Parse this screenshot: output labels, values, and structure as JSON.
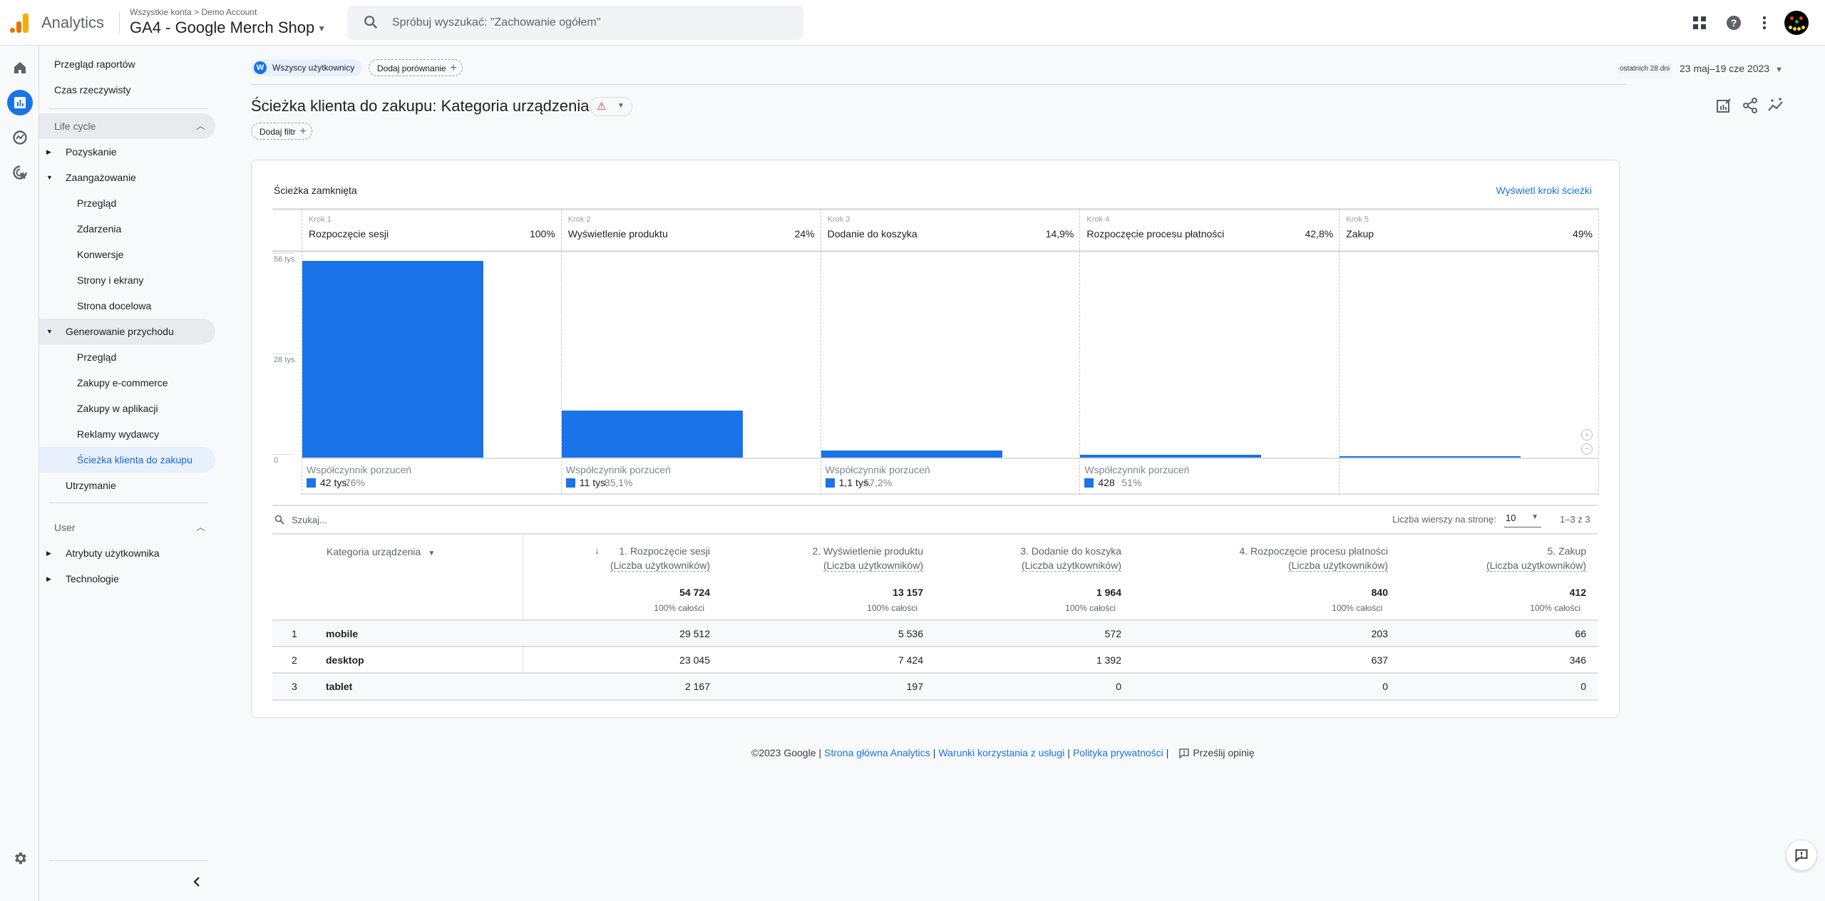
{
  "topbar": {
    "app_name": "Analytics",
    "breadcrumb": "Wszystkie konta > Demo Account",
    "property": "GA4 - Google Merch Shop",
    "search_placeholder": "Spróbuj wyszukać: \"Zachowanie ogółem\"",
    "icons": [
      "apps-grid-icon",
      "help-icon",
      "more-vert-icon",
      "avatar"
    ]
  },
  "rail": {
    "icons": [
      "home-icon",
      "reports-icon",
      "explore-icon",
      "advertising-icon",
      "settings-icon"
    ],
    "active": "reports-icon"
  },
  "sidebar": {
    "top_items": [
      {
        "label": "Przegląd raportów"
      },
      {
        "label": "Czas rzeczywisty"
      }
    ],
    "sections": [
      {
        "title": "Life cycle",
        "expanded": true,
        "groups": [
          {
            "label": "Pozyskanie",
            "expanded": false,
            "items": []
          },
          {
            "label": "Zaangażowanie",
            "expanded": true,
            "items": [
              {
                "label": "Przegląd"
              },
              {
                "label": "Zdarzenia"
              },
              {
                "label": "Konwersje"
              },
              {
                "label": "Strony i ekrany"
              },
              {
                "label": "Strona docelowa"
              }
            ]
          },
          {
            "label": "Generowanie przychodu",
            "expanded": true,
            "items": [
              {
                "label": "Przegląd"
              },
              {
                "label": "Zakupy e-commerce"
              },
              {
                "label": "Zakupy w aplikacji"
              },
              {
                "label": "Reklamy wydawcy"
              },
              {
                "label": "Ścieżka klienta do zakupu",
                "active": true
              }
            ]
          },
          {
            "label": "Utrzymanie",
            "expanded": false,
            "items": []
          }
        ]
      },
      {
        "title": "User",
        "expanded": true,
        "groups": [
          {
            "label": "Atrybuty użytkownika",
            "expanded": false
          },
          {
            "label": "Technologie",
            "expanded": false
          }
        ]
      }
    ]
  },
  "header": {
    "segment_initial": "W",
    "segment_label": "Wszyscy użytkownicy",
    "add_comparison": "Dodaj porównanie",
    "date_badge": "ostatnich 28 dni",
    "date_range": "23 maj–19 cze 2023",
    "title": "Ścieżka klienta do zakupu: Kategoria urządzenia",
    "add_filter": "Dodaj filtr"
  },
  "card": {
    "title": "Ścieżka zamknięta",
    "view_steps_link": "Wyświetl kroki ścieżki",
    "abandon_label": "Współczynnik porzuceń"
  },
  "chart_data": {
    "type": "bar",
    "title": "Ścieżka zamknięta",
    "categories": [
      "Rozpoczęcie sesji",
      "Wyświetlenie produktu",
      "Dodanie do koszyka",
      "Rozpoczęcie procesu płatności",
      "Zakup"
    ],
    "step_labels": [
      "Krok 1",
      "Krok 2",
      "Krok 3",
      "Krok 4",
      "Krok 5"
    ],
    "values": [
      54724,
      13157,
      1964,
      840,
      412
    ],
    "completion_rates": [
      "100%",
      "24%",
      "14,9%",
      "42,8%",
      "49%"
    ],
    "abandonments": [
      {
        "count": "42 tys.",
        "rate": "76%"
      },
      {
        "count": "11 tys.",
        "rate": "85,1%"
      },
      {
        "count": "1,1 tys.",
        "rate": "57,2%"
      },
      {
        "count": "428",
        "rate": "51%"
      },
      null
    ],
    "yticks": [
      {
        "value": 56000,
        "label": "56 tys."
      },
      {
        "value": 28000,
        "label": "28 tys."
      },
      {
        "value": 0,
        "label": "0"
      }
    ],
    "ylim": [
      0,
      56000
    ],
    "xlabel": "",
    "ylabel": "",
    "grid": false
  },
  "table": {
    "search_placeholder": "Szukaj...",
    "rows_per_page_label": "Liczba wierszy na stronę:",
    "rows_per_page": "10",
    "range": "1–3 z 3",
    "dimension_header": "Kategoria urządzenia",
    "columns": [
      {
        "title": "1. Rozpoczęcie sesji",
        "sub": "(Liczba użytkowników)",
        "total": "54 724",
        "total_pct": "100% całości",
        "sorted": true
      },
      {
        "title": "2. Wyświetlenie produktu",
        "sub": "(Liczba użytkowników)",
        "total": "13 157",
        "total_pct": "100% całości"
      },
      {
        "title": "3. Dodanie do koszyka",
        "sub": "(Liczba użytkowników)",
        "total": "1 964",
        "total_pct": "100% całości"
      },
      {
        "title": "4. Rozpoczęcie procesu płatności",
        "sub": "(Liczba użytkowników)",
        "total": "840",
        "total_pct": "100% całości"
      },
      {
        "title": "5. Zakup",
        "sub": "(Liczba użytkowników)",
        "total": "412",
        "total_pct": "100% całości"
      }
    ],
    "rows": [
      {
        "index": "1",
        "dimension": "mobile",
        "values": [
          "29 512",
          "5 536",
          "572",
          "203",
          "66"
        ]
      },
      {
        "index": "2",
        "dimension": "desktop",
        "values": [
          "23 045",
          "7 424",
          "1 392",
          "637",
          "346"
        ]
      },
      {
        "index": "3",
        "dimension": "tablet",
        "values": [
          "2 167",
          "197",
          "0",
          "0",
          "0"
        ]
      }
    ]
  },
  "footer": {
    "copyright": "©2023 Google",
    "links": [
      "Strona główna Analytics",
      "Warunki korzystania z usługi",
      "Polityka prywatności"
    ],
    "feedback": "Prześlij opinię"
  },
  "colors": {
    "accent": "#1a73e8",
    "active_bg": "#e8f0fe",
    "warning": "#d93025"
  }
}
